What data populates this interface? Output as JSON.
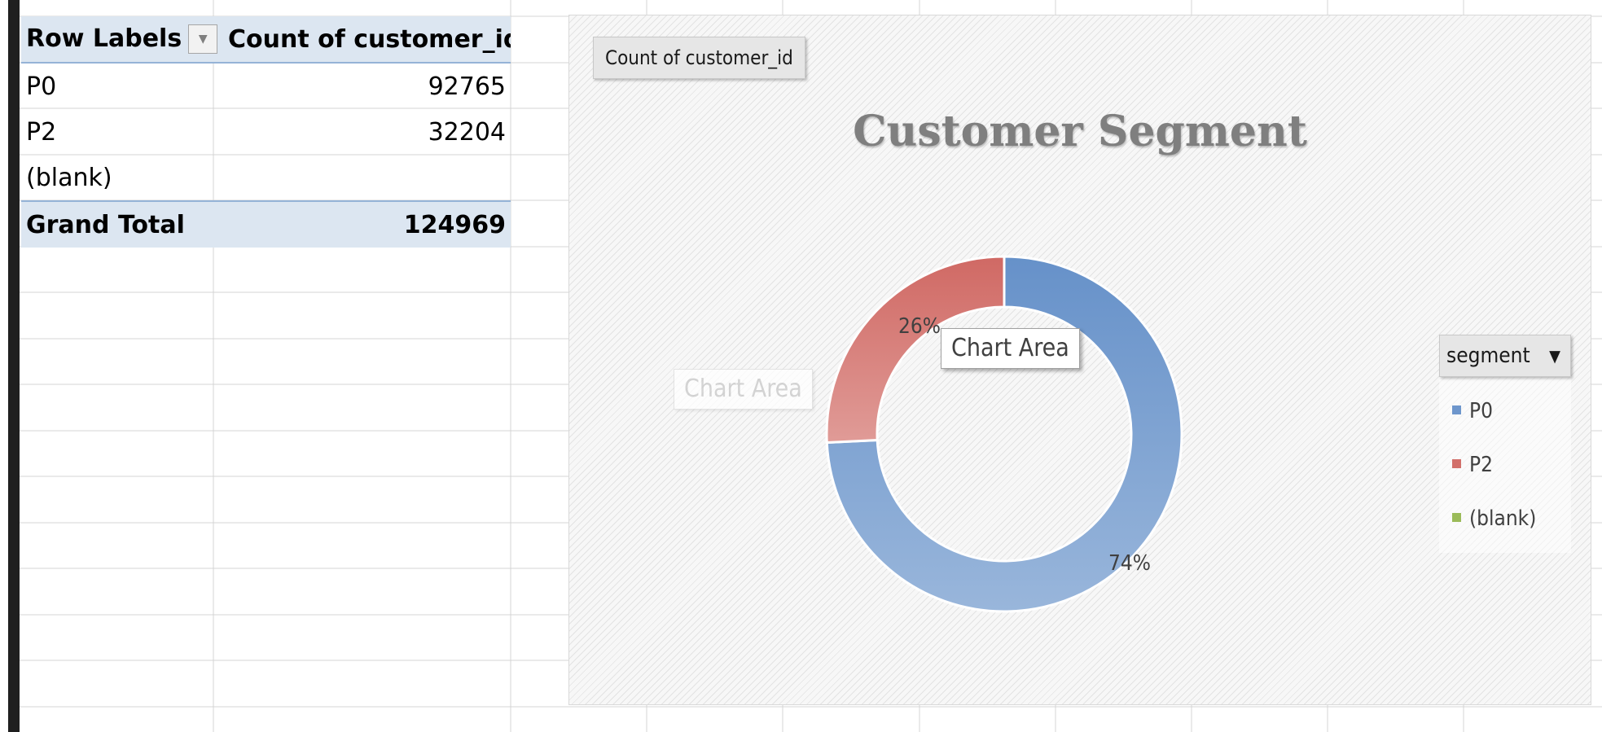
{
  "pivot": {
    "header": {
      "row_labels": "Row Labels",
      "value_field": "Count of customer_id"
    },
    "rows": [
      {
        "label": "P0",
        "value": "92765"
      },
      {
        "label": "P2",
        "value": "32204"
      },
      {
        "label": "(blank)",
        "value": ""
      }
    ],
    "total": {
      "label": "Grand Total",
      "value": "124969"
    }
  },
  "chart": {
    "value_field_button": "Count  of customer_id",
    "legend_field_button": "segment",
    "tooltips": [
      "Chart Area",
      "Chart Area"
    ]
  },
  "chart_data": {
    "type": "pie",
    "donut": true,
    "title": "Customer Segment",
    "categories": [
      "P0",
      "P2",
      "(blank)"
    ],
    "values": [
      92765,
      32204,
      0
    ],
    "data_labels": [
      "74%",
      "26%",
      ""
    ],
    "colors": [
      "#6d96cc",
      "#d2706b",
      "#9bbb59"
    ],
    "legend_position": "right"
  }
}
